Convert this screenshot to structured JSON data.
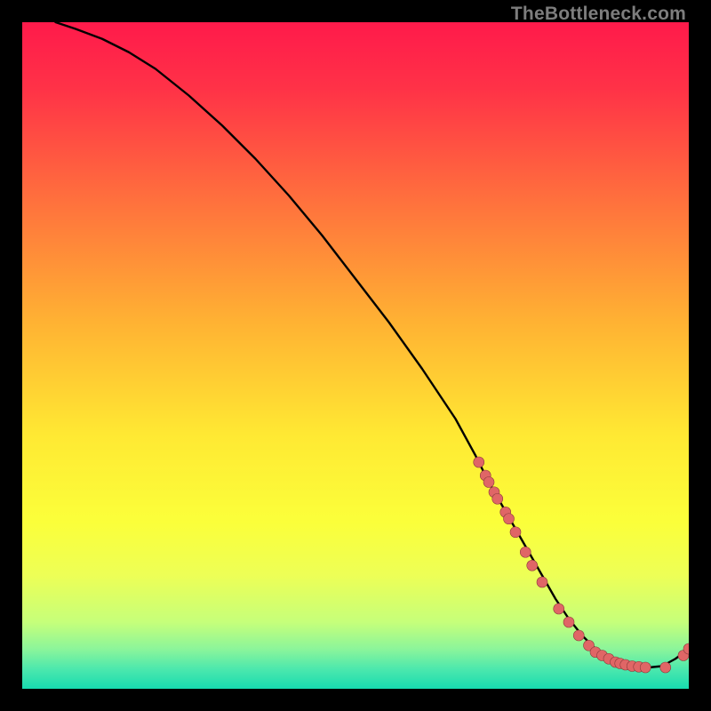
{
  "watermark": "TheBottleneck.com",
  "colors": {
    "background": "#000000",
    "line": "#000000",
    "dot_fill": "#e06666",
    "dot_stroke": "#8a3b3b",
    "gradient_stops": [
      {
        "offset": 0.0,
        "color": "#ff1a4b"
      },
      {
        "offset": 0.1,
        "color": "#ff3247"
      },
      {
        "offset": 0.25,
        "color": "#ff6a3e"
      },
      {
        "offset": 0.45,
        "color": "#ffb233"
      },
      {
        "offset": 0.62,
        "color": "#ffe933"
      },
      {
        "offset": 0.75,
        "color": "#fbff3a"
      },
      {
        "offset": 0.83,
        "color": "#edff56"
      },
      {
        "offset": 0.9,
        "color": "#c6ff7a"
      },
      {
        "offset": 0.94,
        "color": "#8cf59a"
      },
      {
        "offset": 0.97,
        "color": "#4de8ad"
      },
      {
        "offset": 1.0,
        "color": "#17dbb0"
      }
    ]
  },
  "chart_data": {
    "type": "line",
    "title": "",
    "xlabel": "",
    "ylabel": "",
    "xlim": [
      0,
      100
    ],
    "ylim": [
      0,
      100
    ],
    "series": [
      {
        "name": "curve",
        "x": [
          5,
          8,
          12,
          16,
          20,
          25,
          30,
          35,
          40,
          45,
          50,
          55,
          60,
          65,
          68,
          70,
          72,
          74,
          76,
          78,
          80,
          82,
          84,
          86,
          88,
          90,
          92,
          94,
          96,
          98,
          100
        ],
        "y": [
          100,
          99,
          97.5,
          95.5,
          93,
          89,
          84.5,
          79.5,
          74,
          68,
          61.5,
          55,
          48,
          40.5,
          35,
          31,
          27.5,
          24,
          20.5,
          17,
          13.5,
          10.5,
          8,
          6,
          4.5,
          3.7,
          3.3,
          3.2,
          3.4,
          4.5,
          6
        ]
      }
    ],
    "scatter": {
      "name": "dots",
      "x": [
        68.5,
        69.5,
        70,
        70.8,
        71.3,
        72.5,
        73,
        74,
        75.5,
        76.5,
        78,
        80.5,
        82,
        83.5,
        85,
        86,
        87,
        88,
        89,
        89.7,
        90.5,
        91.5,
        92.5,
        93.5,
        96.5,
        99.2,
        100
      ],
      "y": [
        34,
        32,
        31,
        29.5,
        28.5,
        26.5,
        25.5,
        23.5,
        20.5,
        18.5,
        16,
        12,
        10,
        8,
        6.5,
        5.5,
        5,
        4.5,
        4,
        3.8,
        3.6,
        3.4,
        3.3,
        3.2,
        3.2,
        5,
        6
      ]
    }
  }
}
